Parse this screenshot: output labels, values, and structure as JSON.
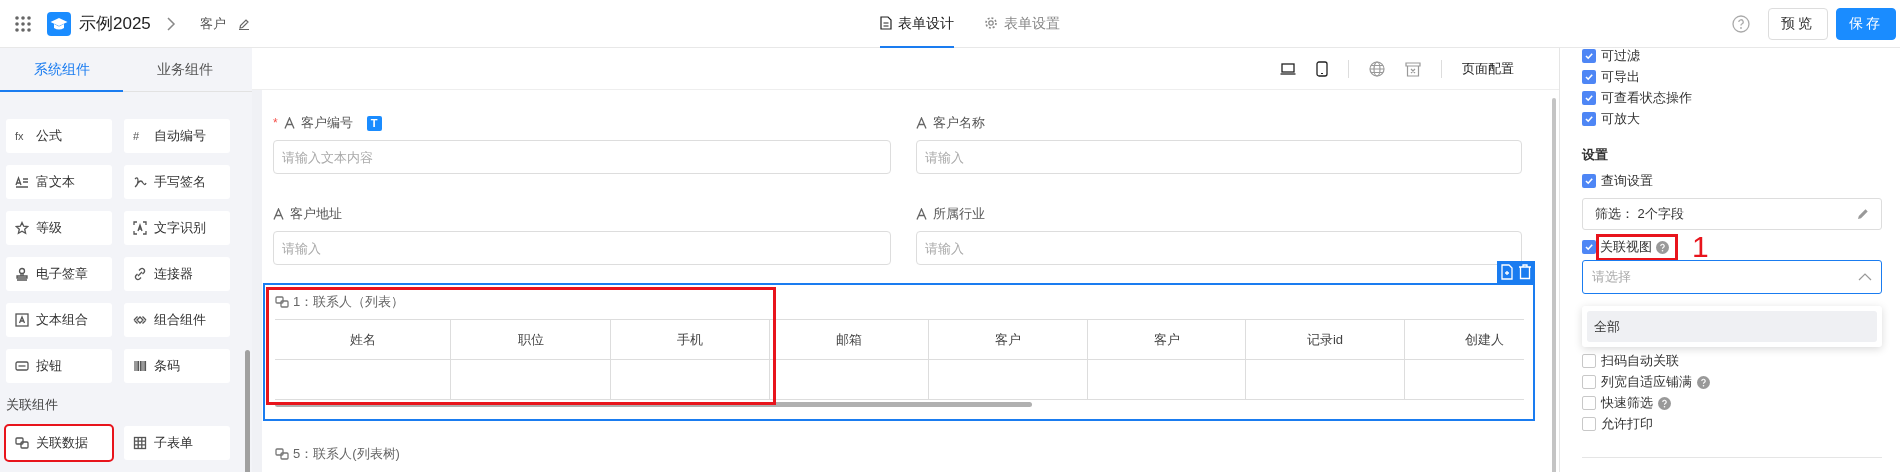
{
  "header": {
    "app_name": "示例2025",
    "page": "客户"
  },
  "tabs": [
    {
      "label": "表单设计",
      "selected": true
    },
    {
      "label": "表单设置",
      "selected": false
    }
  ],
  "header_buttons": [
    {
      "label": "预览",
      "kind": "secondary"
    },
    {
      "label": "保存",
      "kind": "primary"
    }
  ],
  "sidebar": {
    "tabs": [
      {
        "label": "系统组件",
        "selected": true
      },
      {
        "label": "业务组件",
        "selected": false
      }
    ],
    "items": [
      {
        "glyph": "fx",
        "label": "公式"
      },
      {
        "glyph": "#",
        "label": "自动编号"
      },
      {
        "label": "富文本"
      },
      {
        "label": "手写签名"
      },
      {
        "label": "等级"
      },
      {
        "label": "文字识别"
      },
      {
        "label": "电子签章"
      },
      {
        "label": "连接器"
      },
      {
        "label": "文本组合"
      },
      {
        "label": "组合组件"
      },
      {
        "label": "按钮"
      },
      {
        "label": "条码"
      }
    ],
    "related_heading": "关联组件",
    "related_items": [
      {
        "label": "关联数据",
        "highlighted": true
      },
      {
        "label": "子表单",
        "highlighted": false
      }
    ]
  },
  "canvas_toolbar": {
    "page_config": "页面配置"
  },
  "fields": [
    {
      "label": "客户编号",
      "placeholder": "请输入文本内容",
      "required_mark": "*",
      "badge": "T"
    },
    {
      "label": "客户名称",
      "placeholder": "请输入"
    },
    {
      "label": "客户地址",
      "placeholder": "请输入"
    },
    {
      "label": "所属行业",
      "placeholder": "请输入"
    }
  ],
  "subtables": [
    {
      "title": "1：联系人（列表）",
      "selected": true,
      "columns": [
        {
          "label": "姓名",
          "highlighted": true
        },
        {
          "label": "职位",
          "highlighted": true
        },
        {
          "label": "手机",
          "highlighted": true
        },
        {
          "label": "邮箱",
          "highlighted": false
        },
        {
          "label": "客户",
          "highlighted": false
        },
        {
          "label": "客户",
          "highlighted": false
        },
        {
          "label": "记录id",
          "highlighted": false
        },
        {
          "label": "创建人",
          "highlighted": false
        }
      ]
    },
    {
      "title": "5：联系人(列表树)",
      "selected": false
    }
  ],
  "properties": {
    "options_top": [
      {
        "label": "可过滤",
        "checked": true
      },
      {
        "label": "可导出",
        "checked": true
      },
      {
        "label": "可查看状态操作",
        "checked": true
      },
      {
        "label": "可放大",
        "checked": true
      }
    ],
    "settings_heading": "设置",
    "query": {
      "label": "查询设置",
      "checked": true
    },
    "filter": "筛选： 2个字段",
    "related_view": {
      "label": "关联视图",
      "checked": true,
      "help": true,
      "highlighted": true,
      "marker": "1"
    },
    "view_select": {
      "placeholder": "请选择",
      "expanded": true,
      "options": [
        {
          "label": "全部",
          "hovered": true
        }
      ]
    },
    "options_bottom": [
      {
        "label": "扫码自动关联",
        "checked": false,
        "help": false
      },
      {
        "label": "列宽自适应铺满",
        "checked": false,
        "help": true
      },
      {
        "label": "快速筛选",
        "checked": false,
        "help": true
      },
      {
        "label": "允许打印",
        "checked": false,
        "help": false
      }
    ]
  }
}
